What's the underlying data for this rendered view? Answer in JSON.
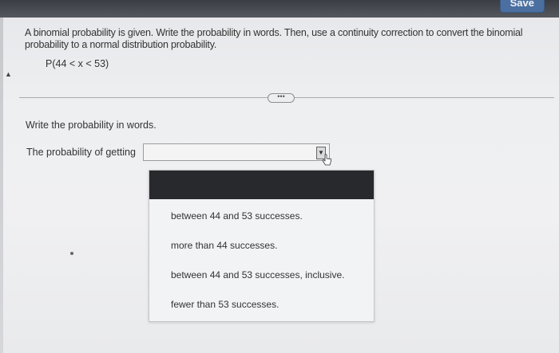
{
  "toolbar": {
    "save_label": "Save"
  },
  "question": {
    "prompt": "A binomial probability is given. Write the probability in words. Then, use a continuity correction to convert the binomial probability to a normal distribution probability.",
    "expression": "P(44 < x < 53)"
  },
  "divider": {
    "ellipsis": "•••"
  },
  "part1": {
    "instruction": "Write the probability in words.",
    "answer_label": "The probability of getting",
    "selected_value": ""
  },
  "dropdown": {
    "options": [
      "between 44 and 53 successes.",
      "more than 44 successes.",
      "between 44 and 53 successes, inclusive.",
      "fewer than 53 successes."
    ]
  },
  "icons": {
    "select_arrow": "dropdown-arrow-icon",
    "cursor": "hand-pointer-icon",
    "side_arrow": "collapse-arrow-icon"
  },
  "colors": {
    "top_bar": "#3a3d44",
    "save_button": "#4a6fa0",
    "dropdown_header": "#28292c",
    "background": "#eeeff1"
  }
}
